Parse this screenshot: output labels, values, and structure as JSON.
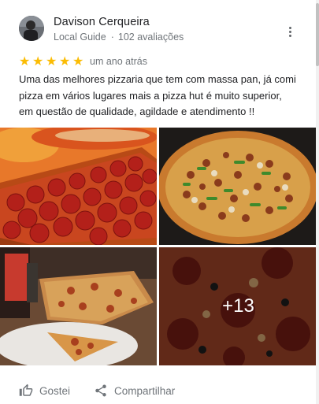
{
  "review": {
    "author_name": "Davison Cerqueira",
    "author_badge": "Local Guide",
    "author_review_count": "102 avaliações",
    "rating": 5,
    "rating_max": 5,
    "date": "um ano atrás",
    "text": "Uma das melhores pizzaria que tem com massa pan, já comi\npizza em vários lugares  mais a pizza hut é muito superior,\nem questão de qualidade,  agildade e atendimento !!"
  },
  "photos": {
    "items": [
      {
        "subject": "pepperoni pan pizza"
      },
      {
        "subject": "supreme pizza with peppers and mushrooms"
      },
      {
        "subject": "pizza on restaurant table"
      },
      {
        "subject": "pepperoni pizza close-up"
      }
    ],
    "more_count_label": "+13"
  },
  "actions": {
    "like_label": "Gostei",
    "share_label": "Compartilhar"
  },
  "icons": {
    "menu": "more-vert-icon",
    "star": "star-icon",
    "like": "thumb-up-icon",
    "share": "share-icon"
  },
  "colors": {
    "star": "#fbbc04",
    "text_secondary": "#70757a",
    "text_primary": "#202124"
  }
}
